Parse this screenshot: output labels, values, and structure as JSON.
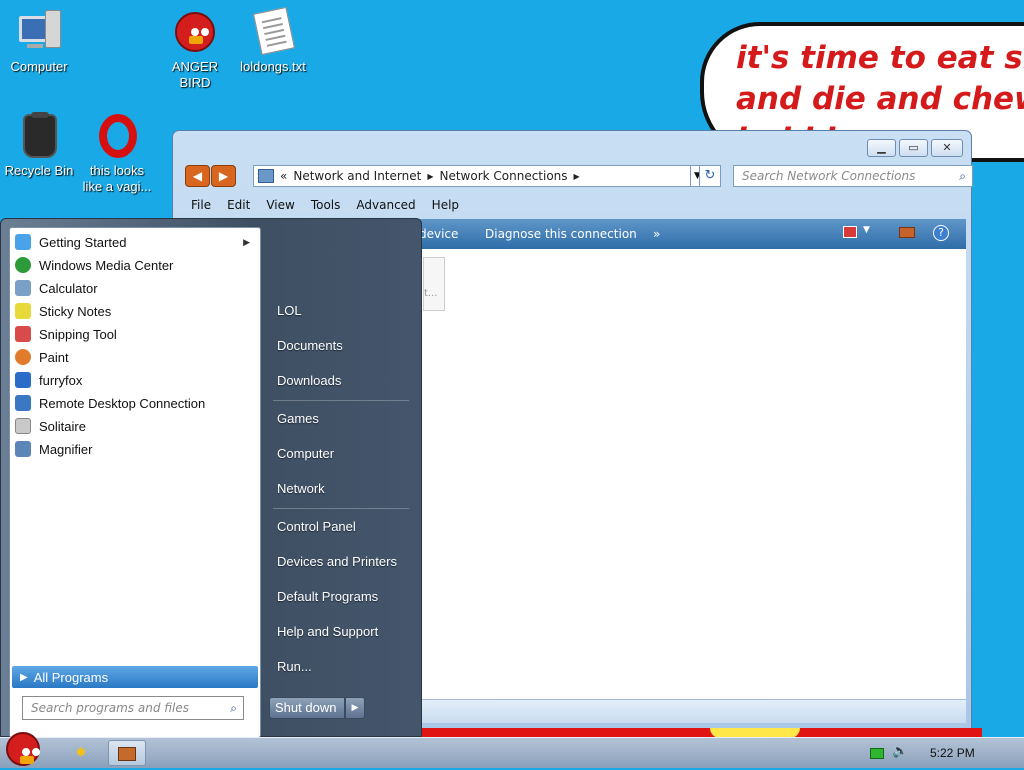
{
  "desktop": {
    "icons": [
      {
        "label": "Computer"
      },
      {
        "label": "ANGER\nBIRD"
      },
      {
        "label": "loldongs.txt"
      },
      {
        "label": "Recycle Bin"
      },
      {
        "label": "this looks\nlike a vagi..."
      }
    ],
    "bubble_text": "it's time to eat shit\nand die and chew\nbubble gum"
  },
  "explorer": {
    "breadcrumb": [
      "Network and Internet",
      "Network Connections"
    ],
    "breadcrumb_prefix": "«",
    "search_placeholder": "Search Network Connections",
    "menu": [
      "File",
      "Edit",
      "View",
      "Tools",
      "Advanced",
      "Help"
    ],
    "commands": [
      "device",
      "Diagnose this connection",
      "»"
    ],
    "ghost_text": "t..."
  },
  "start_menu": {
    "programs": [
      {
        "label": "Getting Started",
        "has_submenu": true,
        "icon_color": "#4aa3e8"
      },
      {
        "label": "Windows Media Center",
        "icon_color": "#2e9b3a"
      },
      {
        "label": "Calculator",
        "icon_color": "#7aa0c8"
      },
      {
        "label": "Sticky Notes",
        "icon_color": "#e8d93a"
      },
      {
        "label": "Snipping Tool",
        "icon_color": "#d94a4a"
      },
      {
        "label": "Paint",
        "icon_color": "#e07c2b"
      },
      {
        "label": "furryfox",
        "icon_color": "#2b6cc9"
      },
      {
        "label": "Remote Desktop Connection",
        "icon_color": "#3a78c4"
      },
      {
        "label": "Solitaire",
        "icon_color": "#c9c9c9"
      },
      {
        "label": "Magnifier",
        "icon_color": "#5c86b8"
      }
    ],
    "all_programs": "All Programs",
    "search_placeholder": "Search programs and files",
    "places": [
      "LOL",
      "Documents",
      "Downloads",
      "Games",
      "Computer",
      "Network",
      "Control Panel",
      "Devices and Printers",
      "Default Programs",
      "Help and Support",
      "Run..."
    ],
    "shutdown_label": "Shut down"
  },
  "taskbar": {
    "clock": "5:22 PM"
  }
}
